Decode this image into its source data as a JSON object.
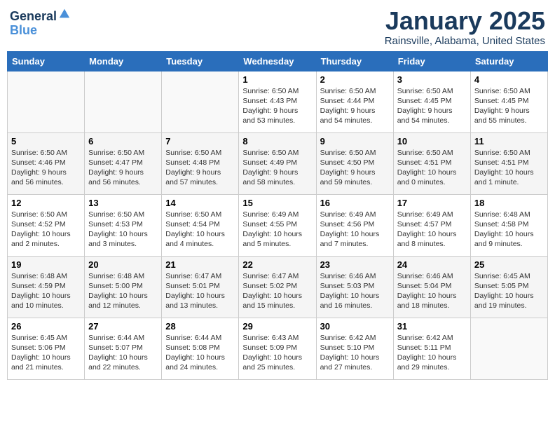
{
  "header": {
    "logo_line1": "General",
    "logo_line2": "Blue",
    "month": "January 2025",
    "location": "Rainsville, Alabama, United States"
  },
  "weekdays": [
    "Sunday",
    "Monday",
    "Tuesday",
    "Wednesday",
    "Thursday",
    "Friday",
    "Saturday"
  ],
  "weeks": [
    [
      {
        "day": "",
        "info": ""
      },
      {
        "day": "",
        "info": ""
      },
      {
        "day": "",
        "info": ""
      },
      {
        "day": "1",
        "info": "Sunrise: 6:50 AM\nSunset: 4:43 PM\nDaylight: 9 hours\nand 53 minutes."
      },
      {
        "day": "2",
        "info": "Sunrise: 6:50 AM\nSunset: 4:44 PM\nDaylight: 9 hours\nand 54 minutes."
      },
      {
        "day": "3",
        "info": "Sunrise: 6:50 AM\nSunset: 4:45 PM\nDaylight: 9 hours\nand 54 minutes."
      },
      {
        "day": "4",
        "info": "Sunrise: 6:50 AM\nSunset: 4:45 PM\nDaylight: 9 hours\nand 55 minutes."
      }
    ],
    [
      {
        "day": "5",
        "info": "Sunrise: 6:50 AM\nSunset: 4:46 PM\nDaylight: 9 hours\nand 56 minutes."
      },
      {
        "day": "6",
        "info": "Sunrise: 6:50 AM\nSunset: 4:47 PM\nDaylight: 9 hours\nand 56 minutes."
      },
      {
        "day": "7",
        "info": "Sunrise: 6:50 AM\nSunset: 4:48 PM\nDaylight: 9 hours\nand 57 minutes."
      },
      {
        "day": "8",
        "info": "Sunrise: 6:50 AM\nSunset: 4:49 PM\nDaylight: 9 hours\nand 58 minutes."
      },
      {
        "day": "9",
        "info": "Sunrise: 6:50 AM\nSunset: 4:50 PM\nDaylight: 9 hours\nand 59 minutes."
      },
      {
        "day": "10",
        "info": "Sunrise: 6:50 AM\nSunset: 4:51 PM\nDaylight: 10 hours\nand 0 minutes."
      },
      {
        "day": "11",
        "info": "Sunrise: 6:50 AM\nSunset: 4:51 PM\nDaylight: 10 hours\nand 1 minute."
      }
    ],
    [
      {
        "day": "12",
        "info": "Sunrise: 6:50 AM\nSunset: 4:52 PM\nDaylight: 10 hours\nand 2 minutes."
      },
      {
        "day": "13",
        "info": "Sunrise: 6:50 AM\nSunset: 4:53 PM\nDaylight: 10 hours\nand 3 minutes."
      },
      {
        "day": "14",
        "info": "Sunrise: 6:50 AM\nSunset: 4:54 PM\nDaylight: 10 hours\nand 4 minutes."
      },
      {
        "day": "15",
        "info": "Sunrise: 6:49 AM\nSunset: 4:55 PM\nDaylight: 10 hours\nand 5 minutes."
      },
      {
        "day": "16",
        "info": "Sunrise: 6:49 AM\nSunset: 4:56 PM\nDaylight: 10 hours\nand 7 minutes."
      },
      {
        "day": "17",
        "info": "Sunrise: 6:49 AM\nSunset: 4:57 PM\nDaylight: 10 hours\nand 8 minutes."
      },
      {
        "day": "18",
        "info": "Sunrise: 6:48 AM\nSunset: 4:58 PM\nDaylight: 10 hours\nand 9 minutes."
      }
    ],
    [
      {
        "day": "19",
        "info": "Sunrise: 6:48 AM\nSunset: 4:59 PM\nDaylight: 10 hours\nand 10 minutes."
      },
      {
        "day": "20",
        "info": "Sunrise: 6:48 AM\nSunset: 5:00 PM\nDaylight: 10 hours\nand 12 minutes."
      },
      {
        "day": "21",
        "info": "Sunrise: 6:47 AM\nSunset: 5:01 PM\nDaylight: 10 hours\nand 13 minutes."
      },
      {
        "day": "22",
        "info": "Sunrise: 6:47 AM\nSunset: 5:02 PM\nDaylight: 10 hours\nand 15 minutes."
      },
      {
        "day": "23",
        "info": "Sunrise: 6:46 AM\nSunset: 5:03 PM\nDaylight: 10 hours\nand 16 minutes."
      },
      {
        "day": "24",
        "info": "Sunrise: 6:46 AM\nSunset: 5:04 PM\nDaylight: 10 hours\nand 18 minutes."
      },
      {
        "day": "25",
        "info": "Sunrise: 6:45 AM\nSunset: 5:05 PM\nDaylight: 10 hours\nand 19 minutes."
      }
    ],
    [
      {
        "day": "26",
        "info": "Sunrise: 6:45 AM\nSunset: 5:06 PM\nDaylight: 10 hours\nand 21 minutes."
      },
      {
        "day": "27",
        "info": "Sunrise: 6:44 AM\nSunset: 5:07 PM\nDaylight: 10 hours\nand 22 minutes."
      },
      {
        "day": "28",
        "info": "Sunrise: 6:44 AM\nSunset: 5:08 PM\nDaylight: 10 hours\nand 24 minutes."
      },
      {
        "day": "29",
        "info": "Sunrise: 6:43 AM\nSunset: 5:09 PM\nDaylight: 10 hours\nand 25 minutes."
      },
      {
        "day": "30",
        "info": "Sunrise: 6:42 AM\nSunset: 5:10 PM\nDaylight: 10 hours\nand 27 minutes."
      },
      {
        "day": "31",
        "info": "Sunrise: 6:42 AM\nSunset: 5:11 PM\nDaylight: 10 hours\nand 29 minutes."
      },
      {
        "day": "",
        "info": ""
      }
    ]
  ]
}
